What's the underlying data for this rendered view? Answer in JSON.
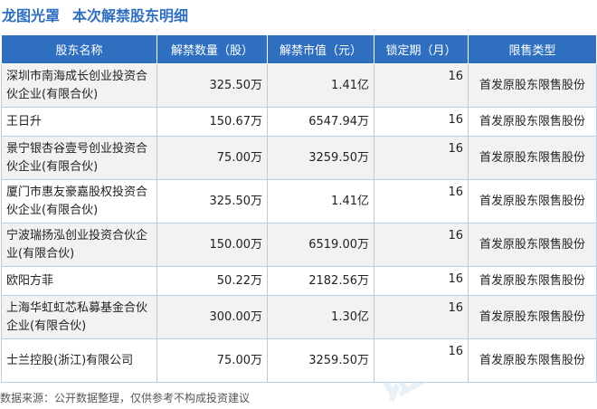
{
  "title": {
    "company": "龙图光罩",
    "subtitle": "本次解禁股东明细"
  },
  "table": {
    "headers": [
      "股东名称",
      "解禁数量（股）",
      "解禁市值（元）",
      "锁定期（月）",
      "限售类型"
    ],
    "rows": [
      {
        "name": "深圳市南海成长创业投资合伙企业(有限合伙)",
        "shares": "325.50万",
        "value": "1.41亿",
        "period": "16",
        "type": "首发原股东限售股份"
      },
      {
        "name": "王日升",
        "shares": "150.67万",
        "value": "6547.94万",
        "period": "16",
        "type": "首发原股东限售股份"
      },
      {
        "name": "景宁银杏谷壹号创业投资合伙企业(有限合伙)",
        "shares": "75.00万",
        "value": "3259.50万",
        "period": "16",
        "type": "首发原股东限售股份"
      },
      {
        "name": "厦门市惠友豪嘉股权投资合伙企业(有限合伙)",
        "shares": "325.50万",
        "value": "1.41亿",
        "period": "16",
        "type": "首发原股东限售股份"
      },
      {
        "name": "宁波瑞扬泓创业投资合伙企业(有限合伙)",
        "shares": "150.00万",
        "value": "6519.00万",
        "period": "16",
        "type": "首发原股东限售股份"
      },
      {
        "name": "欧阳方菲",
        "shares": "50.22万",
        "value": "2182.56万",
        "period": "16",
        "type": "首发原股东限售股份"
      },
      {
        "name": "上海华虹虹芯私募基金合伙企业(有限合伙)",
        "shares": "300.00万",
        "value": "1.30亿",
        "period": "16",
        "type": "首发原股东限售股份"
      },
      {
        "name": "士兰控股(浙江)有限公司",
        "shares": "75.00万",
        "value": "3259.50万",
        "period": "16",
        "type": "首发原股东限售股份"
      }
    ]
  },
  "source": "数据来源：公开数据整理，仅供参考不构成投资建议",
  "watermark": "证券之星",
  "colors": {
    "header_bg": "#2f6fbf",
    "title": "#2f6fbf",
    "stripe": "#f2f2f2"
  }
}
